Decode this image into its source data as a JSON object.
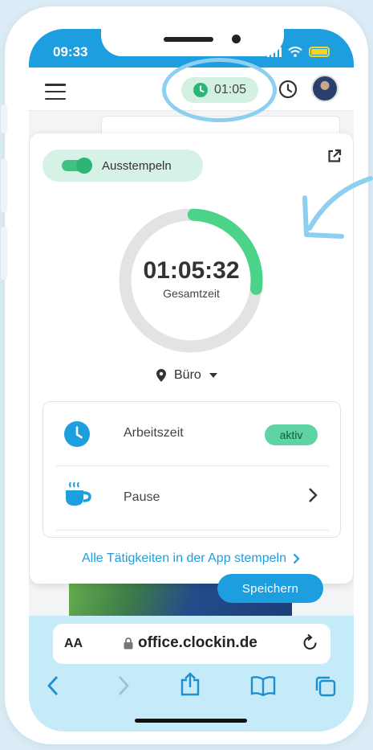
{
  "status": {
    "time": "09:33"
  },
  "header": {
    "timer": "01:05"
  },
  "panel": {
    "toggle_label": "Ausstempeln",
    "progress_fraction": 0.27,
    "total_time": "01:05:32",
    "total_label": "Gesamtzeit",
    "location": "Büro",
    "activities": [
      {
        "label": "Arbeitszeit",
        "badge": "aktiv"
      },
      {
        "label": "Pause"
      }
    ],
    "all_link": "Alle Tätigkeiten in der App stempeln"
  },
  "save_label": "Speichern",
  "browser": {
    "aa": "AA",
    "url": "office.clockin.de"
  },
  "colors": {
    "brand": "#1d9ede",
    "accent_green": "#3fc383",
    "highlight": "#8ccff0"
  }
}
